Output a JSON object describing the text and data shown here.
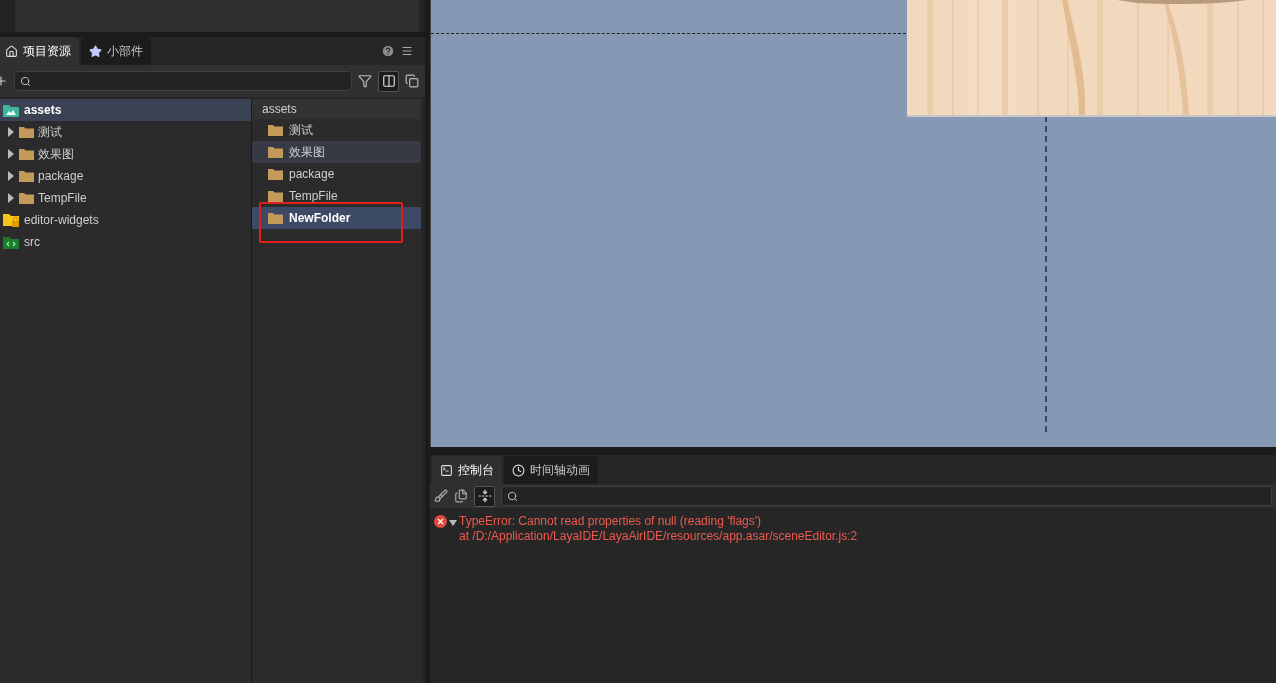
{
  "project_panel": {
    "tabs": [
      {
        "label": "项目资源",
        "selected": true
      },
      {
        "label": "小部件",
        "selected": false
      }
    ],
    "toolbar": {
      "two_column_view": true
    },
    "tree": [
      {
        "label": "assets",
        "kind": "assets",
        "selected": true,
        "children": [
          {
            "label": "测试",
            "kind": "folder",
            "selected": false,
            "expanded": false
          },
          {
            "label": "效果图",
            "kind": "folder",
            "selected": false,
            "expanded": false
          },
          {
            "label": "package",
            "kind": "folder",
            "selected": false,
            "expanded": false
          },
          {
            "label": "TempFile",
            "kind": "folder",
            "selected": false,
            "expanded": false
          }
        ]
      },
      {
        "label": "editor-widgets",
        "kind": "locked",
        "selected": false
      },
      {
        "label": "src",
        "kind": "code",
        "selected": false
      }
    ],
    "list_header": "assets",
    "list": [
      {
        "label": "测试",
        "selected": false,
        "hovered": false,
        "annotated": false
      },
      {
        "label": "效果图",
        "selected": false,
        "hovered": true,
        "annotated": false
      },
      {
        "label": "package",
        "selected": false,
        "hovered": false,
        "annotated": false
      },
      {
        "label": "TempFile",
        "selected": false,
        "hovered": false,
        "annotated": false
      },
      {
        "label": "NewFolder",
        "selected": true,
        "hovered": false,
        "annotated": true
      }
    ]
  },
  "console_panel": {
    "tabs": [
      {
        "label": "控制台",
        "selected": true
      },
      {
        "label": "时间轴动画",
        "selected": false
      }
    ],
    "wrap_enabled": true,
    "messages": [
      {
        "kind": "error",
        "expanded": true,
        "lines": [
          "TypeError: Cannot read properties of null (reading 'flags')",
          "at /D:/Application/LayaIDE/LayaAirIDE/resources/app.asar/sceneEditor.js:2"
        ]
      }
    ]
  }
}
